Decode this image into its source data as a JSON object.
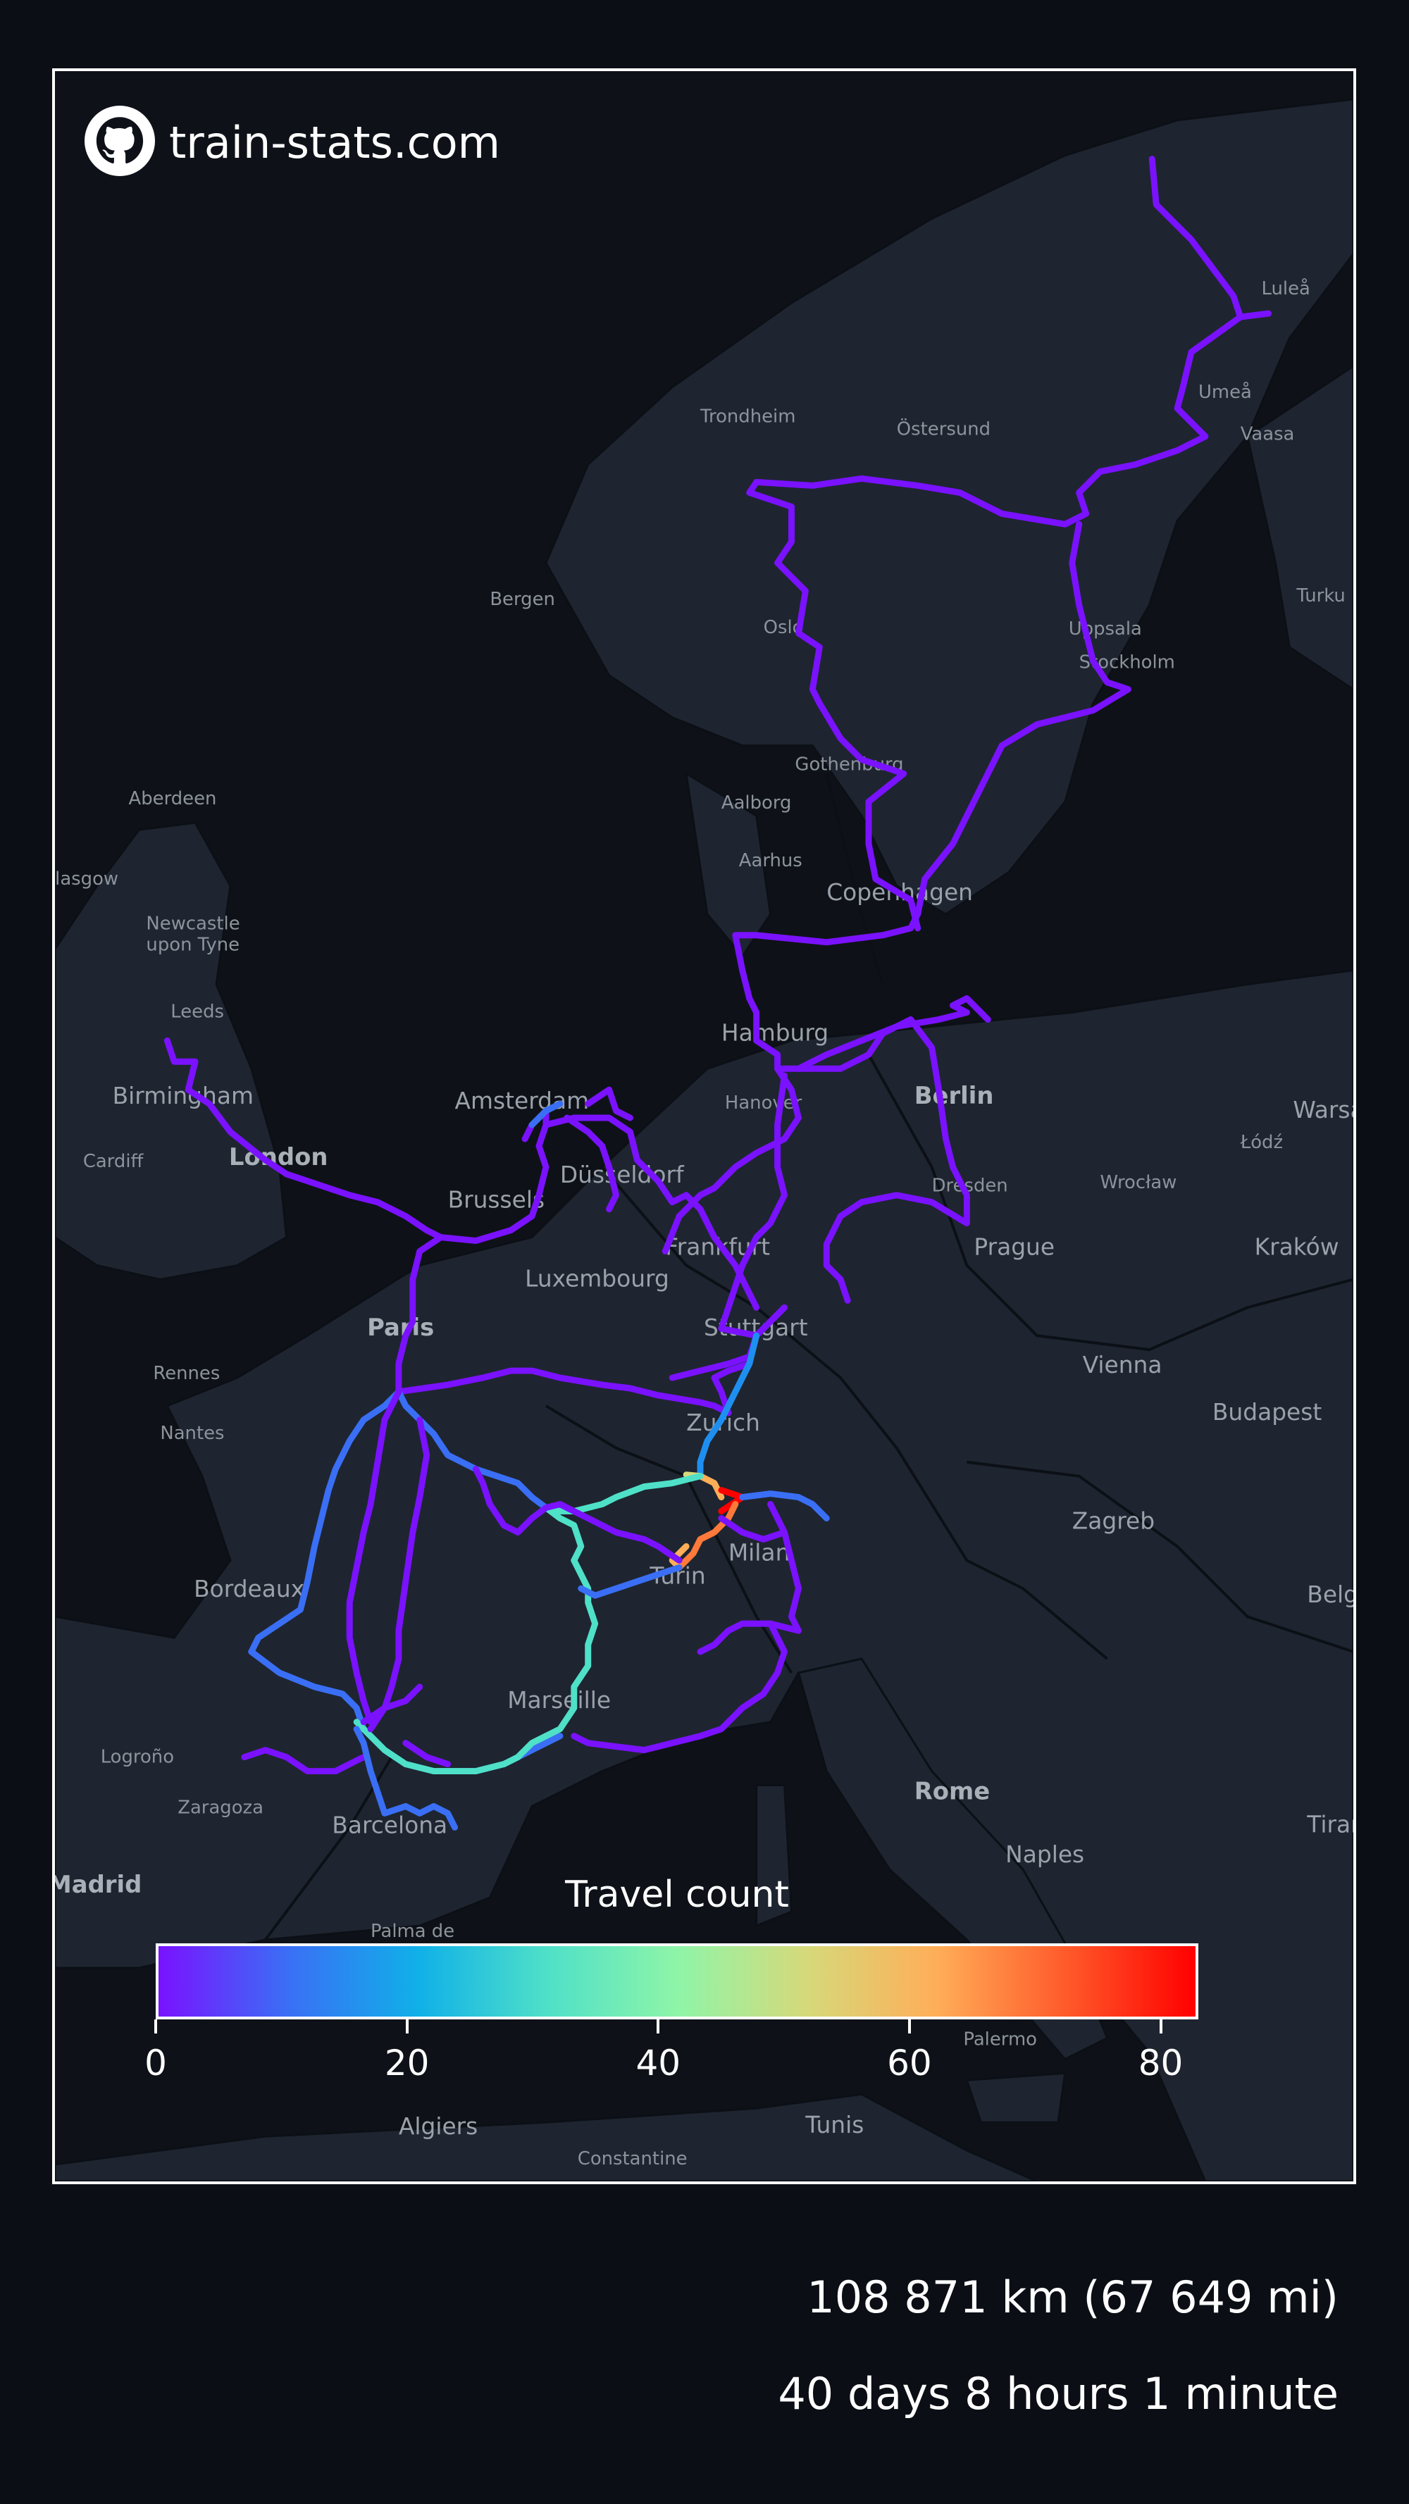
{
  "brand": {
    "icon": "github-icon",
    "text": "train-stats.com"
  },
  "map": {
    "basemap": "dark",
    "cities": [
      {
        "name": "Luleå"
      },
      {
        "name": "Umeå"
      },
      {
        "name": "Vaasa"
      },
      {
        "name": "Östersund"
      },
      {
        "name": "Trondheim"
      },
      {
        "name": "Turku"
      },
      {
        "name": "Bergen"
      },
      {
        "name": "Oslo"
      },
      {
        "name": "Uppsala"
      },
      {
        "name": "Stockholm"
      },
      {
        "name": "Gothenburg"
      },
      {
        "name": "Aalborg"
      },
      {
        "name": "Aarhus"
      },
      {
        "name": "Copenhagen"
      },
      {
        "name": "Aberdeen"
      },
      {
        "name": "Glasgow"
      },
      {
        "name": "Newcastle upon Tyne"
      },
      {
        "name": "Leeds"
      },
      {
        "name": "Birmingham"
      },
      {
        "name": "Cardiff"
      },
      {
        "name": "London"
      },
      {
        "name": "Amsterdam"
      },
      {
        "name": "Hamburg"
      },
      {
        "name": "Hanover"
      },
      {
        "name": "Berlin"
      },
      {
        "name": "Warsaw"
      },
      {
        "name": "Łódź"
      },
      {
        "name": "Düsseldorf"
      },
      {
        "name": "Brussels"
      },
      {
        "name": "Dresden"
      },
      {
        "name": "Wrocław"
      },
      {
        "name": "Frankfurt"
      },
      {
        "name": "Prague"
      },
      {
        "name": "Kraków"
      },
      {
        "name": "Luxembourg"
      },
      {
        "name": "Paris"
      },
      {
        "name": "Stuttgart"
      },
      {
        "name": "Rennes"
      },
      {
        "name": "Vienna"
      },
      {
        "name": "Nantes"
      },
      {
        "name": "Zurich"
      },
      {
        "name": "Budapest"
      },
      {
        "name": "Zagreb"
      },
      {
        "name": "Milan"
      },
      {
        "name": "Turin"
      },
      {
        "name": "Bordeaux"
      },
      {
        "name": "Belgrade"
      },
      {
        "name": "Marseille"
      },
      {
        "name": "Logroño"
      },
      {
        "name": "Zaragoza"
      },
      {
        "name": "Barcelona"
      },
      {
        "name": "Rome"
      },
      {
        "name": "Tirana"
      },
      {
        "name": "Naples"
      },
      {
        "name": "Madrid"
      },
      {
        "name": "Palma de Mallorca"
      },
      {
        "name": "Palermo"
      },
      {
        "name": "Algiers"
      },
      {
        "name": "Tunis"
      },
      {
        "name": "Constantine"
      }
    ]
  },
  "legend": {
    "title": "Travel count",
    "min": 0,
    "max": 83,
    "ticks": [
      "0",
      "20",
      "40",
      "60",
      "80"
    ],
    "colormap": [
      "#7a12ff",
      "#3a6ff5",
      "#10b0e8",
      "#4fe0c8",
      "#8ef5a8",
      "#d6d97a",
      "#ffae58",
      "#ff5a2a",
      "#ff0000"
    ]
  },
  "stats": {
    "distance": "108 871 km (67 649 mi)",
    "duration": "40 days 8 hours 1 minute"
  }
}
